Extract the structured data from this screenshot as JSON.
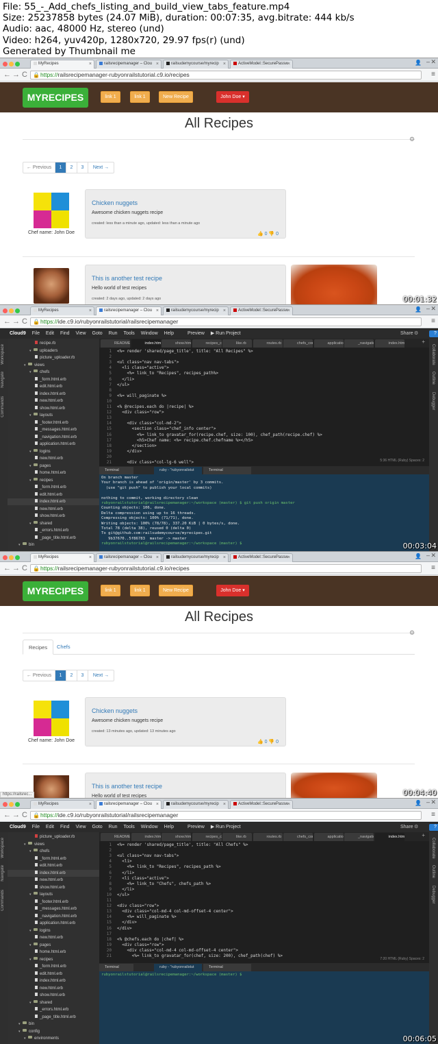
{
  "header": {
    "line1": "File: 55_-_Add_chefs_listing_and_build_view_tabs_feature.mp4",
    "line2": "Size: 25237858 bytes (24.07 MiB), duration: 00:07:35, avg.bitrate: 444 kb/s",
    "line3": "Audio: aac, 48000 Hz, stereo (und)",
    "line4": "Video: h264, yuv420p, 1280x720, 29.97 fps(r) (und)",
    "line5": "Generated by Thumbnail me"
  },
  "chrome": {
    "tabs_site": [
      "MyRecipes",
      "railsrecipemanager – Clou",
      "railsudemycourse/myrecip",
      "ActiveModel::SecurePassw"
    ],
    "tabs_ide": [
      "MyRecipes",
      "railsrecipemanager – Clou",
      "railsudemycourse/myrecip",
      "ActiveModel::SecurePassw"
    ],
    "close_glyph": "×",
    "url_site_scheme": "https://",
    "url_site_rest": "railsrecipemanager-rubyonrailstutorial.c9.io/recipes",
    "url_ide_scheme": "https://",
    "url_ide_rest": "ide.c9.io/rubyonrailstutorial/railsrecipemanager",
    "back": "←",
    "fwd": "→",
    "reload": "C",
    "menu": "≡",
    "lock": "🔒",
    "user": "👤",
    "minimize": "–",
    "close_window": "✕"
  },
  "frames": [
    {
      "timestamp": "00:01:32"
    },
    {
      "timestamp": "00:03:04"
    },
    {
      "timestamp": "00:04:40"
    },
    {
      "timestamp": "00:06:05"
    }
  ],
  "site": {
    "brand": "MYRECIPES",
    "link1": "link 1",
    "link2": "link 1",
    "new_recipe": "New Recipe",
    "user_menu": "John Doe ▾",
    "page_title": "All Recipes",
    "gear": "⚙",
    "pager": [
      "← Previous",
      "1",
      "2",
      "3",
      "Next →"
    ],
    "tabs": [
      "Recipes",
      "Chefs"
    ],
    "chef_name": "Chef name: John Doe",
    "recipe1_title": "Chicken nuggets",
    "recipe1_desc": "Awesome chicken nuggets recipe",
    "recipe1_dates_a": "created: less than a minute ago, updated: less than a minute ago",
    "recipe1_dates_b": "created: 13 minutes ago, updated: 13 minutes ago",
    "likes": "👍 0     👎 0",
    "recipe2_title": "This is another test recipe",
    "recipe2_desc": "Hello world of test recipes",
    "recipe2_dates": "created: 2 days ago, updated: 2 days ago",
    "status_url": "https://railsrec..."
  },
  "ide": {
    "logo": "Cloud9",
    "menu": [
      "File",
      "Edit",
      "Find",
      "View",
      "Goto",
      "Run",
      "Tools",
      "Window",
      "Help"
    ],
    "preview": "Preview",
    "run_project": "▶ Run Project",
    "share": "Share",
    "help": "?",
    "left_labels": [
      "Workspace",
      "Navigate",
      "Commands"
    ],
    "right_labels": [
      "Collaborate",
      "Outline",
      "Debugger"
    ],
    "editor_tabs": [
      "README",
      "index.htm",
      "show.htm",
      "recipes_c",
      "like.rb",
      "routes.rb",
      "chefs_cor",
      "applicatio",
      "_navigatic",
      "index.htm"
    ],
    "term_tabs": [
      "Terminal",
      "ruby - \"rubyonrailstut",
      "Terminal"
    ],
    "tree1": [
      "recipe.rb",
      "uploaders",
      "picture_uploader.rb",
      "views",
      "chefs",
      "_form.html.erb",
      "edit.html.erb",
      "index.html.erb",
      "new.html.erb",
      "show.html.erb",
      "layouts",
      "_footer.html.erb",
      "_messages.html.erb",
      "_navigation.html.erb",
      "application.html.erb",
      "logins",
      "new.html.erb",
      "pages",
      "home.html.erb",
      "recipes",
      "_form.html.erb",
      "edit.html.erb",
      "index.html.erb",
      "new.html.erb",
      "show.html.erb",
      "shared",
      "_errors.html.erb",
      "_page_title.html.erb",
      "bin"
    ],
    "tree2": [
      "picture_uploader.rb",
      "views",
      "chefs",
      "_form.html.erb",
      "edit.html.erb",
      "index.html.erb",
      "new.html.erb",
      "show.html.erb",
      "layouts",
      "_footer.html.erb",
      "_messages.html.erb",
      "_navigation.html.erb",
      "application.html.erb",
      "logins",
      "new.html.erb",
      "pages",
      "home.html.erb",
      "recipes",
      "_form.html.erb",
      "edit.html.erb",
      "index.html.erb",
      "new.html.erb",
      "show.html.erb",
      "shared",
      "_errors.html.erb",
      "_page_title.html.erb",
      "bin",
      "config",
      "environments"
    ],
    "code1": [
      "<%= render 'shared/page_title', title: \"All Recipes\" %>",
      "",
      "<ul class=\"nav nav-tabs\">",
      "  <li class=\"active\">",
      "    <%= link_to \"Recipes\", recipes_path%>",
      "  </li>",
      "</ul>",
      "",
      "<%= will_paginate %>",
      "",
      "<% @recipes.each do |recipe| %>",
      "  <div class=\"row\">",
      "",
      "    <div class=\"col-md-2\">",
      "      <section class=\"chef_info center\">",
      "        <%= link_to gravatar_for(recipe.chef, size: 100), chef_path(recipe.chef) %>",
      "        <h5>Chef name: <%= recipe.chef.chefname %></h5>",
      "      </section>",
      "    </div>",
      "",
      "    <div class=\"col-lg-6 well\">"
    ],
    "code2": [
      "<%= render 'shared/page_title', title: \"All Chefs\" %>",
      "",
      "<ul class=\"nav nav-tabs\">",
      "  <li>",
      "    <%= link_to \"Recipes\", recipes_path %>",
      "  </li>",
      "  <li class=\"active\">",
      "    <%= link_to \"Chefs\", chefs_path %>",
      "  </li>",
      "</ul>",
      "",
      "<div class=\"row\">",
      "  <div class=\"col-md-4 col-md-offset-4 center\">",
      "    <%= will_paginate %>",
      "  </div>",
      "</div>",
      "",
      "<% @chefs.each do |chef| %>",
      "  <div class=\"row\">",
      "    <div class=\"col-md-4 col-md-offset-4 center\">",
      "      <%= link_to gravatar_for(chef, size: 200), chef_path(chef) %>"
    ],
    "edstatus1": "5:36   HTML (Ruby)   Spaces: 2",
    "edstatus2": "7:20   HTML (Ruby)   Spaces: 2",
    "term1": [
      "On branch master",
      "Your branch is ahead of 'origin/master' by 3 commits.",
      "  (use \"git push\" to publish your local commits)",
      "",
      "nothing to commit, working directory clean",
      "rubyonrailstutorial@railsrecipemanager:~/workspace (master) $ git push origin master",
      "Counting objects: 106, done.",
      "Delta compression using up to 16 threads.",
      "Compressing objects: 100% (71/71), done.",
      "Writing objects: 100% (78/78), 337.20 KiB | 0 bytes/s, done.",
      "Total 78 (delta 38), reused 0 (delta 0)",
      "To git@github.com:railsudemycourse/myrecipes.git",
      "   9b37670..5f86783  master -> master",
      "rubyonrailstutorial@railsrecipemanager:~/workspace (master) $"
    ],
    "term2": [
      "rubyonrailstutorial@railsrecipemanager:~/workspace (master) $"
    ]
  },
  "colors": {
    "brand_green": "#3bb039",
    "nav_brown": "#4a3424",
    "btn_orange": "#f0ad4e",
    "btn_red": "#d9302c",
    "link_blue": "#337ab7",
    "ide_dark": "#1f1f1f",
    "term_blue": "#1a3a52"
  }
}
